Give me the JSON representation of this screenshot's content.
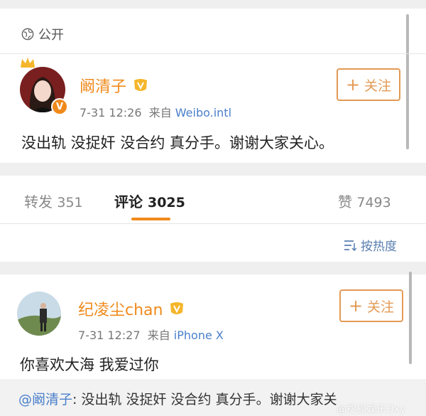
{
  "post": {
    "visibility": "公开",
    "author": "阚清子",
    "verified_badge": "V",
    "time": "7-31 12:26",
    "source_prefix": "来自",
    "source": "Weibo.intl",
    "follow_label": "关注",
    "content": "没出轨 没捉奸 没合约 真分手。谢谢大家关心。"
  },
  "tabs": [
    {
      "label": "转发",
      "count": "351"
    },
    {
      "label": "评论",
      "count": "3025"
    },
    {
      "label": "赞",
      "count": "7493"
    }
  ],
  "sort_label": "按热度",
  "comment": {
    "author": "纪凌尘chan",
    "time": "7-31 12:27",
    "source_prefix": "来自",
    "source": "iPhone X",
    "follow_label": "关注",
    "content": "你喜欢大海 我爱过你"
  },
  "quote": {
    "mention": "@阚清子",
    "text": ": 没出轨 没捉奸 没合约 真分手。谢谢大家关"
  },
  "watermark": "@搜狐娱乐Oxy",
  "colors": {
    "accent": "#f08a1c",
    "link": "#4a7fcb",
    "follow_border": "#e39a55"
  }
}
